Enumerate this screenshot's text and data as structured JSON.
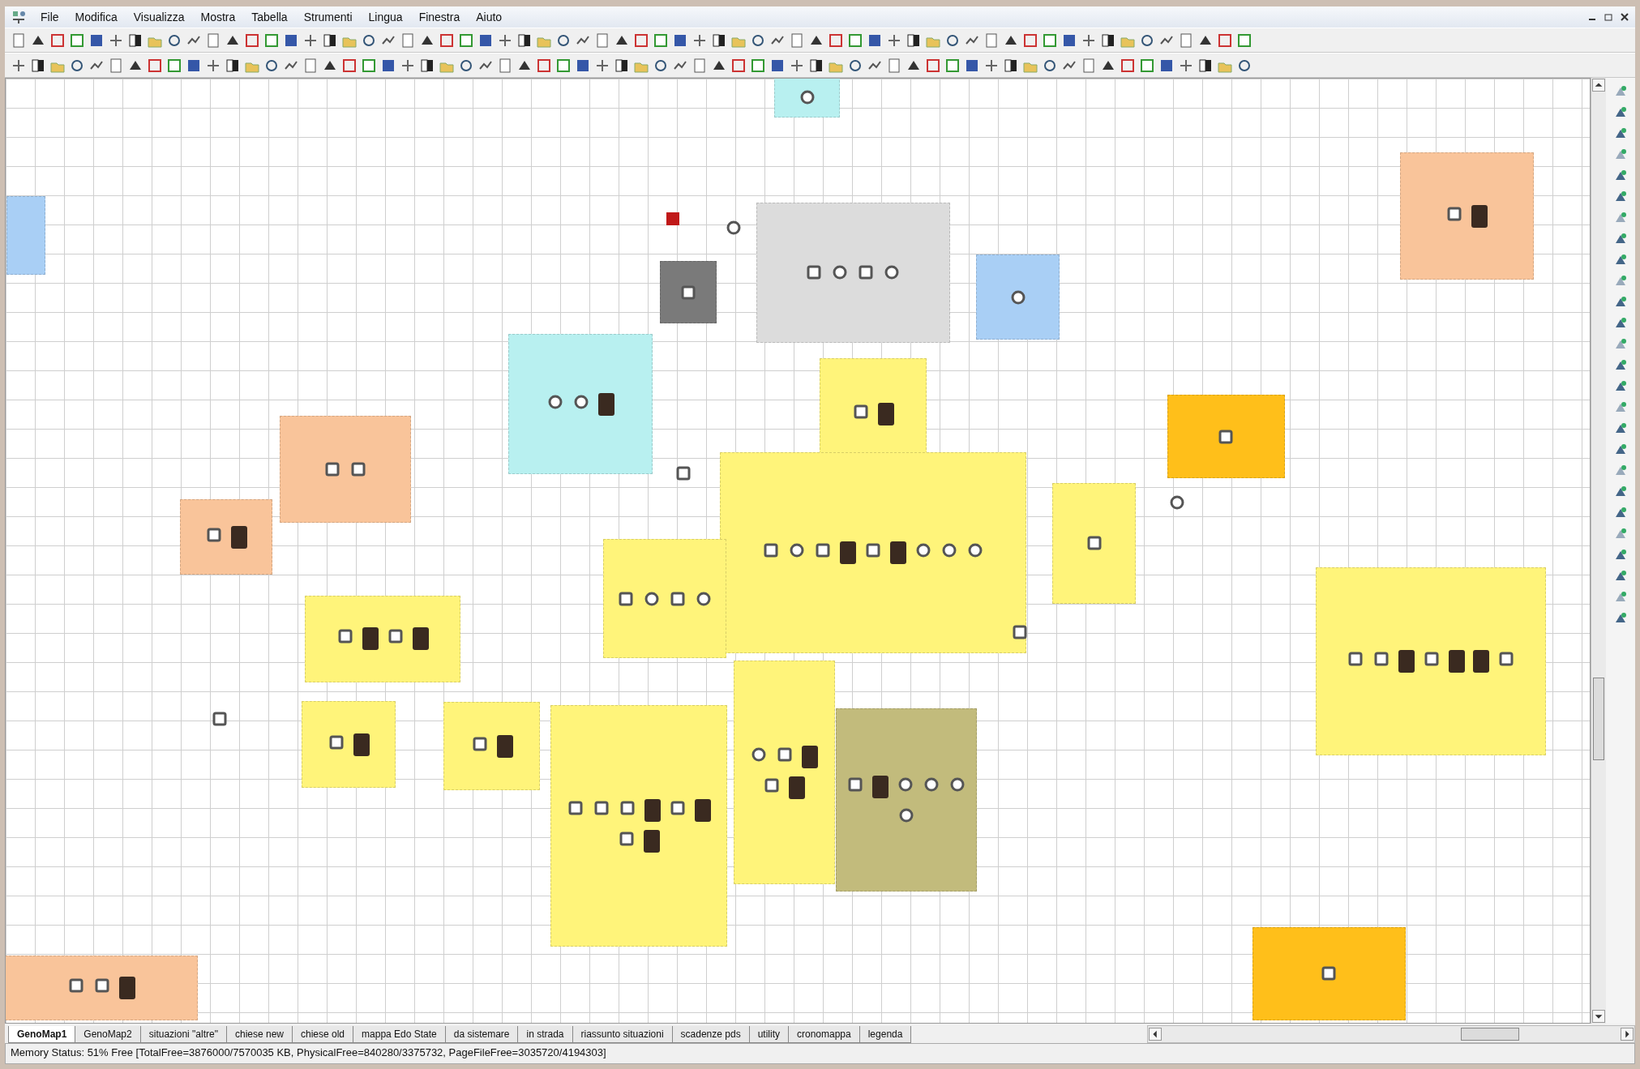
{
  "menu": [
    "File",
    "Modifica",
    "Visualizza",
    "Mostra",
    "Tabella",
    "Strumenti",
    "Lingua",
    "Finestra",
    "Aiuto"
  ],
  "canvas": {
    "areas": [
      {
        "color": "#b8f0f0",
        "members": [
          {
            "kind": "female"
          }
        ]
      },
      {
        "color": "#a9cff5"
      },
      {
        "color": "#f9c49a",
        "members": [
          {
            "kind": "male"
          },
          {
            "kind": "photo"
          }
        ]
      },
      {
        "color": "#dcdcdc",
        "members": [
          {
            "kind": "male"
          },
          {
            "kind": "female"
          },
          {
            "kind": "male"
          },
          {
            "kind": "female"
          }
        ]
      },
      {
        "color": "#7a7a7a",
        "members": [
          {
            "kind": "male"
          }
        ]
      },
      {
        "color": "#a9cff5",
        "members": [
          {
            "kind": "female"
          }
        ]
      },
      {
        "color": "#b8f0f0",
        "members": [
          {
            "kind": "female"
          },
          {
            "kind": "female"
          },
          {
            "kind": "photo"
          }
        ]
      },
      {
        "color": "#fff47a",
        "members": [
          {
            "kind": "male"
          },
          {
            "kind": "photo"
          }
        ]
      },
      {
        "color": "#f9c49a",
        "members": [
          {
            "kind": "male"
          },
          {
            "kind": "male"
          }
        ]
      },
      {
        "color": "#ffbf1a",
        "members": [
          {
            "kind": "male"
          }
        ]
      },
      {
        "color": "#fff47a",
        "members": [
          {
            "kind": "male"
          },
          {
            "kind": "female"
          },
          {
            "kind": "male"
          },
          {
            "kind": "photo"
          },
          {
            "kind": "male"
          },
          {
            "kind": "photo"
          },
          {
            "kind": "female"
          },
          {
            "kind": "female"
          },
          {
            "kind": "female"
          }
        ]
      },
      {
        "color": "#f9c49a",
        "members": [
          {
            "kind": "male"
          },
          {
            "kind": "photo"
          }
        ]
      },
      {
        "color": "#fff47a",
        "members": [
          {
            "kind": "male"
          }
        ]
      },
      {
        "color": "#fff47a",
        "members": [
          {
            "kind": "male"
          },
          {
            "kind": "female"
          },
          {
            "kind": "male"
          },
          {
            "kind": "female"
          }
        ]
      },
      {
        "color": "#fff47a",
        "members": [
          {
            "kind": "male"
          },
          {
            "kind": "male"
          },
          {
            "kind": "photo"
          },
          {
            "kind": "male"
          },
          {
            "kind": "photo"
          },
          {
            "kind": "photo"
          },
          {
            "kind": "male"
          }
        ]
      },
      {
        "color": "#fff47a",
        "members": [
          {
            "kind": "male"
          },
          {
            "kind": "photo"
          },
          {
            "kind": "male"
          },
          {
            "kind": "photo"
          }
        ]
      },
      {
        "color": "#fff47a",
        "members": [
          {
            "kind": "male"
          },
          {
            "kind": "photo"
          }
        ]
      },
      {
        "color": "#fff47a",
        "members": [
          {
            "kind": "male"
          },
          {
            "kind": "photo"
          }
        ]
      },
      {
        "color": "#fff47a",
        "members": [
          {
            "kind": "male"
          },
          {
            "kind": "male"
          },
          {
            "kind": "male"
          },
          {
            "kind": "photo"
          },
          {
            "kind": "male"
          },
          {
            "kind": "photo"
          },
          {
            "kind": "male"
          },
          {
            "kind": "photo"
          }
        ]
      },
      {
        "color": "#fff47a",
        "members": [
          {
            "kind": "female"
          },
          {
            "kind": "male"
          },
          {
            "kind": "photo"
          },
          {
            "kind": "male"
          },
          {
            "kind": "photo"
          }
        ]
      },
      {
        "color": "#c2bb7c",
        "members": [
          {
            "kind": "male"
          },
          {
            "kind": "photo"
          },
          {
            "kind": "female"
          },
          {
            "kind": "female"
          },
          {
            "kind": "female"
          },
          {
            "kind": "female"
          }
        ]
      },
      {
        "color": "#f9c49a",
        "members": [
          {
            "kind": "male"
          },
          {
            "kind": "male"
          },
          {
            "kind": "photo"
          }
        ]
      },
      {
        "color": "#ffbf1a",
        "members": [
          {
            "kind": "male"
          }
        ]
      }
    ],
    "nodes": [
      {
        "kind": "marked"
      },
      {
        "kind": "female"
      },
      {
        "kind": "male"
      },
      {
        "kind": "female"
      },
      {
        "kind": "male"
      },
      {
        "kind": "male"
      }
    ]
  },
  "tabs": [
    {
      "label": "GenoMap1",
      "selected": true
    },
    {
      "label": "GenoMap2",
      "selected": false
    },
    {
      "label": "situazioni \"altre\"",
      "selected": false
    },
    {
      "label": "chiese new",
      "selected": false
    },
    {
      "label": "chiese old",
      "selected": false
    },
    {
      "label": "mappa Edo State",
      "selected": false
    },
    {
      "label": "da sistemare",
      "selected": false
    },
    {
      "label": "in strada",
      "selected": false
    },
    {
      "label": "riassunto situazioni",
      "selected": false
    },
    {
      "label": "scadenze pds",
      "selected": false
    },
    {
      "label": "utility",
      "selected": false
    },
    {
      "label": "cronomappa",
      "selected": false
    },
    {
      "label": "legenda",
      "selected": false
    }
  ],
  "status_bar": "Memory Status: 51% Free [TotalFree=3876000/7570035 KB, PhysicalFree=840280/3375732, PageFileFree=3035720/4194303]"
}
